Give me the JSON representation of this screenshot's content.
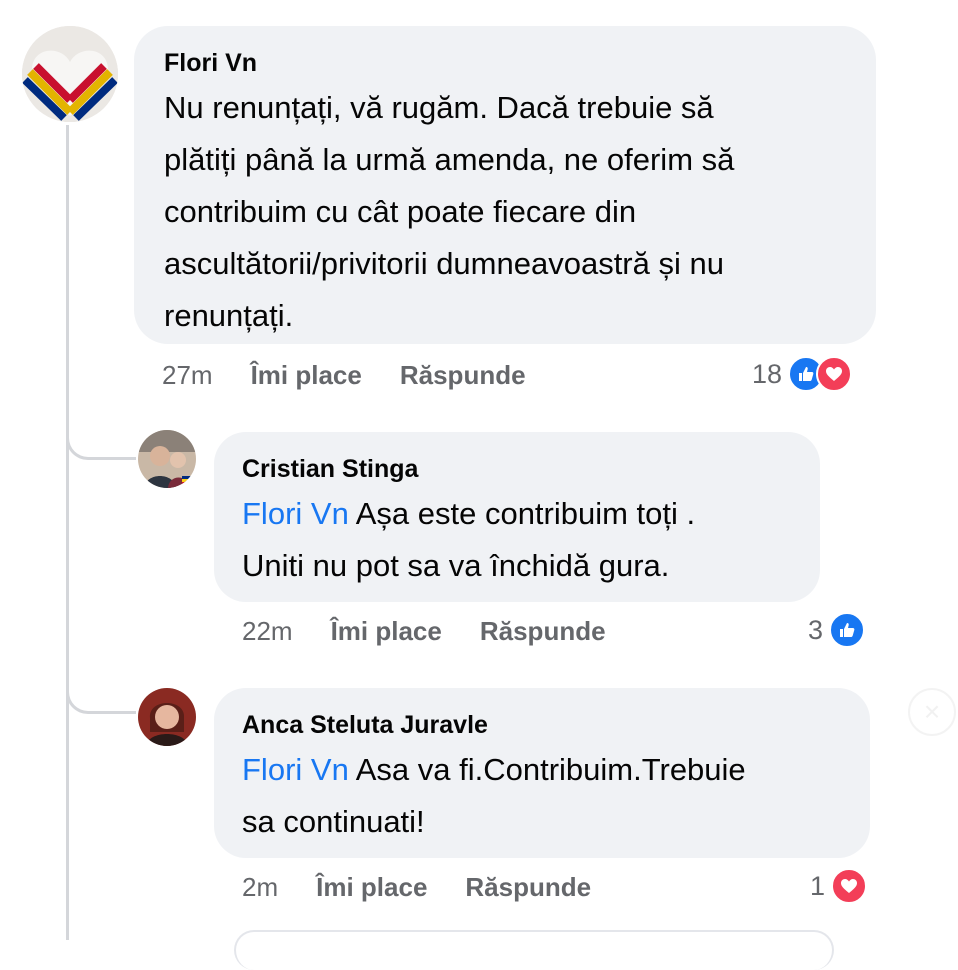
{
  "comments": [
    {
      "author": "Flori Vn",
      "lines": [
        "Nu renunțați, vă rugăm. Dacă trebuie să",
        "plătiți până la urmă amenda, ne oferim să",
        "contribuim cu cât poate fiecare din",
        "ascultătorii/privitorii dumneavoastră și nu",
        "renunțați."
      ],
      "time": "27m",
      "like_label": "Îmi place",
      "reply_label": "Răspunde",
      "reaction_count": "18",
      "reactions": [
        "like-icon",
        "love-icon"
      ]
    }
  ],
  "replies": [
    {
      "author": "Cristian Stinga",
      "mention": "Flori Vn",
      "line1_rest": " Așa este contribuim toți .",
      "line2": "Uniti nu pot sa va închidă gura.",
      "time": "22m",
      "like_label": "Îmi place",
      "reply_label": "Răspunde",
      "reaction_count": "3",
      "reactions": [
        "like-icon"
      ]
    },
    {
      "author": "Anca Steluta Juravle",
      "mention": "Flori Vn",
      "line1_rest": " Asa va fi.Contribuim.Trebuie",
      "line2": "sa continuati!",
      "time": "2m",
      "like_label": "Îmi place",
      "reply_label": "Răspunde",
      "reaction_count": "1",
      "reactions": [
        "love-icon"
      ]
    }
  ],
  "colors": {
    "bubble": "#f0f2f5",
    "mention": "#1877f2",
    "meta": "#65676b",
    "like": "#1877f2",
    "love": "#f33e58"
  }
}
